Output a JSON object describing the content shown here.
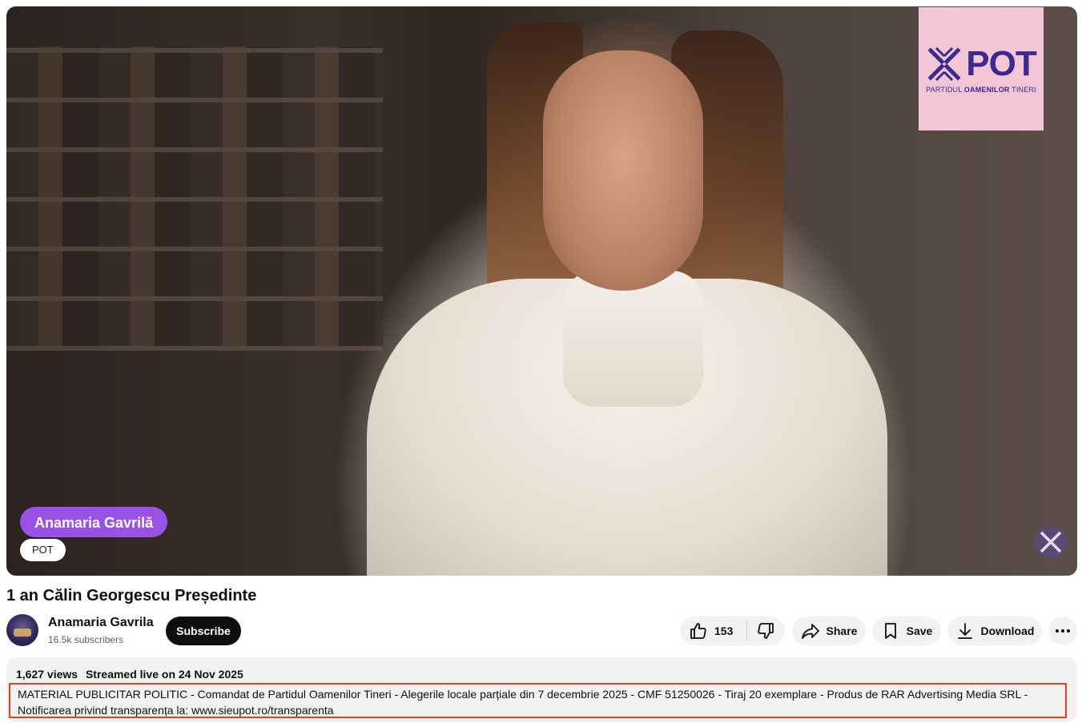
{
  "video": {
    "channel_logo": {
      "text": "POT",
      "subtitle_pre": "PARTIDUL ",
      "subtitle_bold": "OAMENILOR",
      "subtitle_post": " TINERI",
      "bg_color": "#f3c6d6",
      "text_color": "#3b2a8f"
    },
    "lower_third": {
      "name": "Anamaria Gavrilă",
      "party": "POT",
      "name_color": "#9a52e6"
    },
    "corner_icon": "pot-x-logo-icon"
  },
  "title": "1 an Călin Georgescu Președinte",
  "channel": {
    "name": "Anamaria Gavrila",
    "subscribers": "16.5k subscribers",
    "subscribe_label": "Subscribe"
  },
  "actions": {
    "like_count": "153",
    "share_label": "Share",
    "save_label": "Save",
    "download_label": "Download",
    "icons": [
      "thumbs-up-icon",
      "thumbs-down-icon",
      "share-icon",
      "bookmark-icon",
      "download-icon",
      "more-icon"
    ]
  },
  "description": {
    "views": "1,627 views",
    "streamed": "Streamed live on 24 Nov 2025",
    "text": "MATERIAL PUBLICITAR POLITIC - Comandat de Partidul Oamenilor Tineri - Alegerile locale parțiale din 7 decembrie 2025 - CMF 51250026 - Tiraj 20 exemplare - Produs de RAR Advertising Media SRL - Notificarea privind transparența la: www.sieupot.ro/transparenta",
    "highlight_color": "#e8401f"
  }
}
